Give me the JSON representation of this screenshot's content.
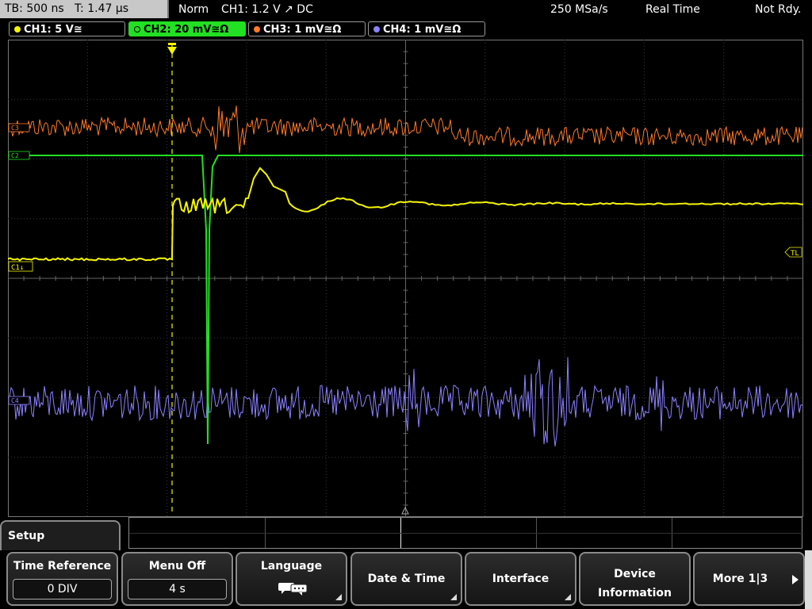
{
  "topbar": {
    "timebase": "TB: 500 ns",
    "trigger_time": "T: 1.47 µs",
    "mode": "Norm",
    "trigger": "CH1: 1.2 V ↗ DC",
    "sample_rate": "250 MSa/s",
    "acq": "Real Time",
    "status": "Not Rdy."
  },
  "channels": [
    {
      "label": "CH1: 5 V≅",
      "color": "#f5f500"
    },
    {
      "label": "CH2: 20 mV≅Ω",
      "color": "#22e022"
    },
    {
      "label": "CH3: 1 mV≅Ω",
      "color": "#ff7a2a"
    },
    {
      "label": "CH4: 1 mV≅Ω",
      "color": "#8c82ff"
    }
  ],
  "markers": {
    "c1": "C1↓",
    "c2": "C2",
    "c3": "C3",
    "c4": "C4",
    "tl": "TL",
    "trig": "T"
  },
  "setup": {
    "title": "Setup"
  },
  "softkeys": {
    "time_reference": {
      "label": "Time Reference",
      "value": "0 DIV"
    },
    "menu_off": {
      "label": "Menu Off",
      "value": "4 s"
    },
    "language": {
      "label": "Language",
      "icon": "speech-bubbles-icon"
    },
    "date_time": {
      "label": "Date & Time"
    },
    "interface": {
      "label": "Interface"
    },
    "device_info": {
      "line1": "Device",
      "line2": "Information"
    },
    "more": {
      "label": "More 1|3"
    }
  }
}
